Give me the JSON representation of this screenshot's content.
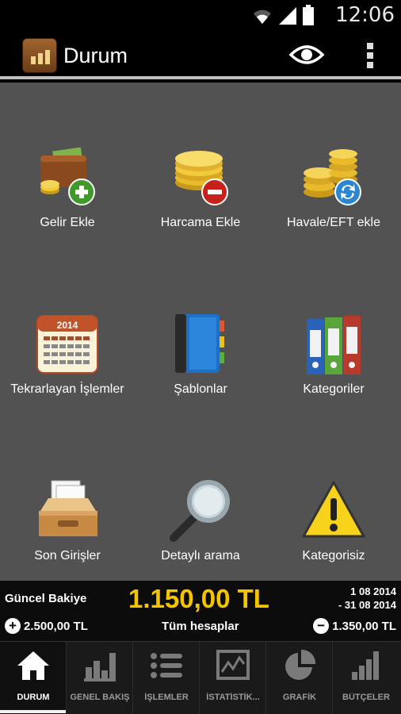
{
  "statusbar": {
    "time": "12:06"
  },
  "app": {
    "title": "Durum"
  },
  "tiles": [
    {
      "label": "Gelir Ekle",
      "icon": "wallet-plus-icon"
    },
    {
      "label": "Harcama Ekle",
      "icon": "coins-minus-icon"
    },
    {
      "label": "Havale/EFT ekle",
      "icon": "coins-transfer-icon"
    },
    {
      "label": "Tekrarlayan İşlemler",
      "icon": "calendar-icon",
      "calendar_year": "2014"
    },
    {
      "label": "Şablonlar",
      "icon": "notebook-icon"
    },
    {
      "label": "Kategoriler",
      "icon": "binders-icon"
    },
    {
      "label": "Son Girişler",
      "icon": "inbox-tray-icon"
    },
    {
      "label": "Detaylı arama",
      "icon": "magnifier-icon"
    },
    {
      "label": "Kategorisiz",
      "icon": "warning-icon"
    }
  ],
  "balance": {
    "label": "Güncel Bakiye",
    "amount": "1.150,00 TL",
    "date_from": "1 08 2014",
    "date_to": "- 31 08 2014",
    "income": "2.500,00 TL",
    "accounts": "Tüm hesaplar",
    "expense": "1.350,00 TL"
  },
  "tabs": [
    {
      "label": "DURUM",
      "active": true
    },
    {
      "label": "GENEL BAKIŞ"
    },
    {
      "label": "İŞLEMLER"
    },
    {
      "label": "İSTATİSTİK..."
    },
    {
      "label": "GRAFİK"
    },
    {
      "label": "BÜTÇELER"
    }
  ],
  "colors": {
    "background": "#525252",
    "accent": "#f5c400",
    "bar": "#000000"
  }
}
